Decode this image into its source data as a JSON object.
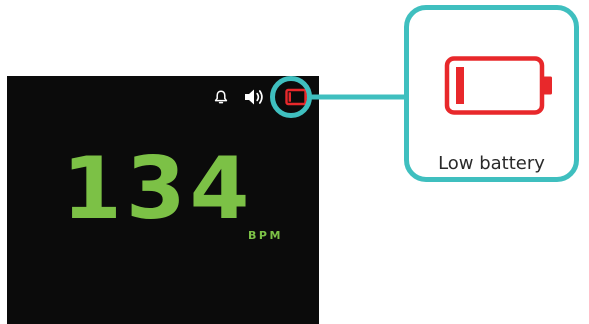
{
  "monitor": {
    "bpm_value": "134",
    "bpm_unit": "BPM",
    "colors": {
      "screen_background": "#0b0b0b",
      "value_color": "#7cc146",
      "icon_color": "#ffffff",
      "battery_alert_color": "#e8282b",
      "highlight_color": "#3fbfbf"
    },
    "status_icons": [
      "bell-icon",
      "speaker-icon",
      "battery-low-icon"
    ]
  },
  "callout": {
    "label": "Low battery",
    "icon": "battery-low-icon"
  }
}
